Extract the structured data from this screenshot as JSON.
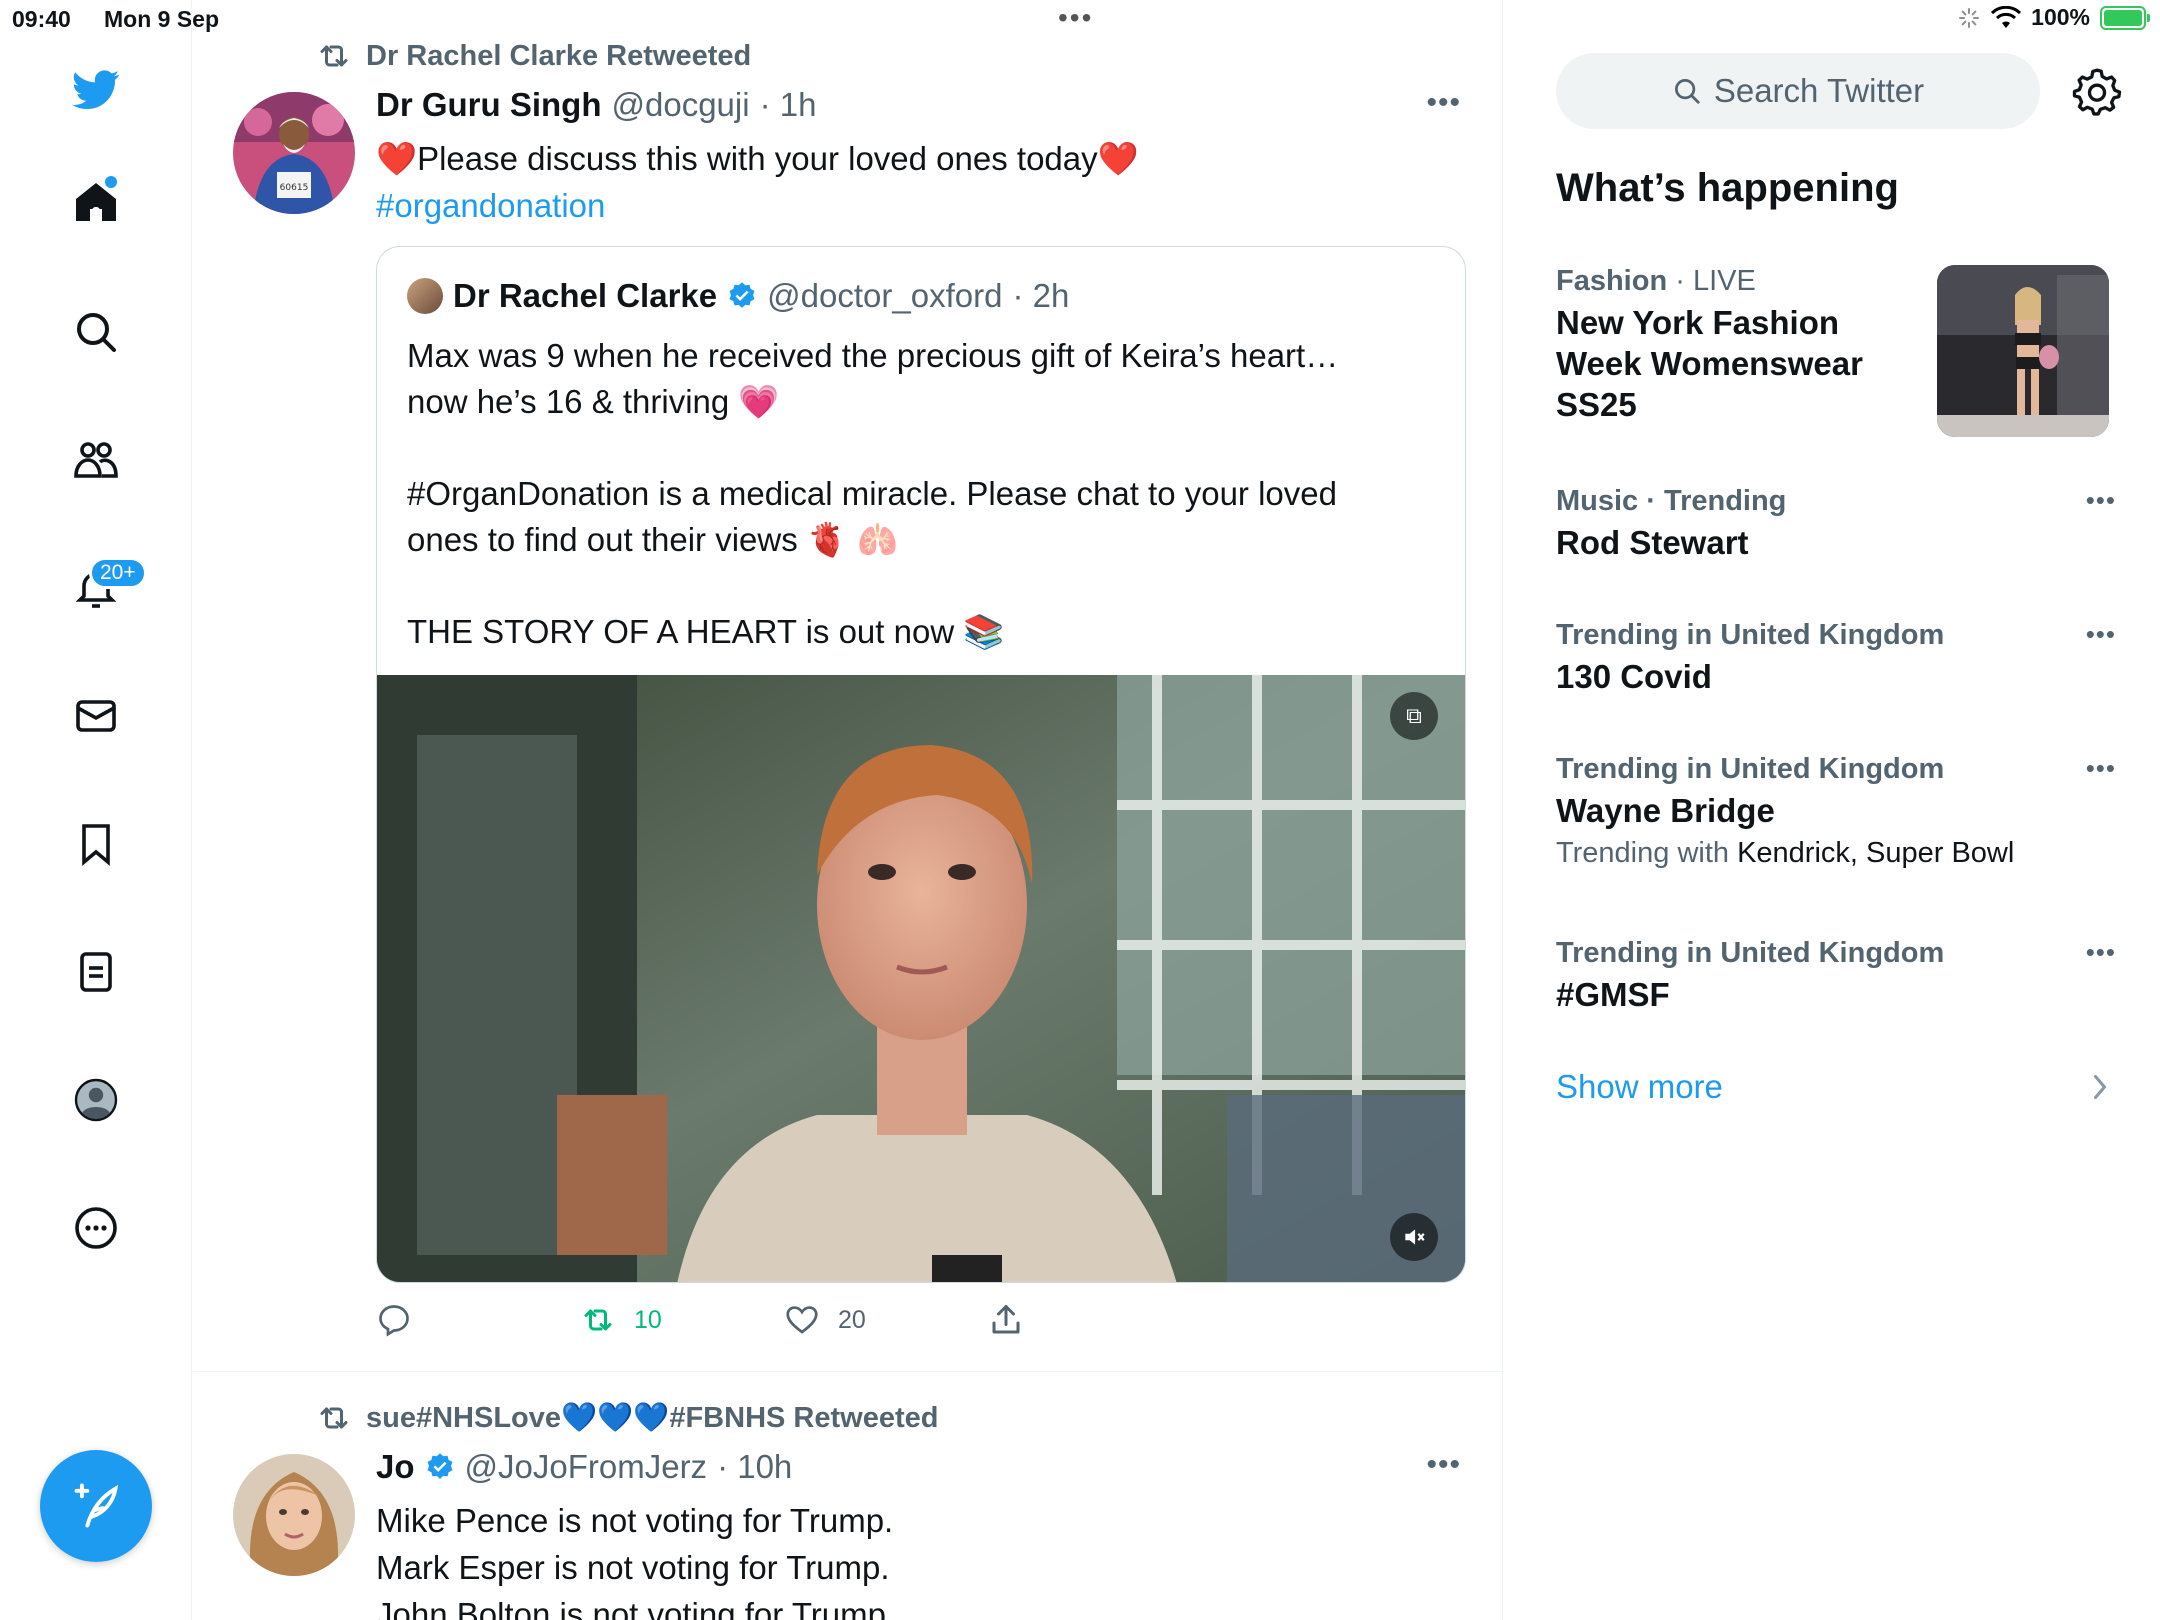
{
  "status_bar": {
    "time": "09:40",
    "date": "Mon 9 Sep",
    "battery": "100%"
  },
  "sidebar": {
    "notifications_badge": "20+",
    "items": [
      "home",
      "explore",
      "communities",
      "notifications",
      "messages",
      "bookmarks",
      "lists",
      "profile",
      "more"
    ]
  },
  "tweets": [
    {
      "retweeted_by": "Dr Rachel Clarke Retweeted",
      "name": "Dr Guru Singh",
      "handle": "@docguji",
      "time": "· 1h",
      "text_prefix": "❤️",
      "text": "Please discuss this with your loved ones today",
      "text_suffix": "❤️",
      "hashtag": "#organdonation",
      "quote": {
        "name": "Dr Rachel Clarke",
        "handle": "@doctor_oxford",
        "time": "· 2h",
        "text": "Max was 9 when he received the precious gift of Keira’s heart…\nnow he’s 16 & thriving 💗\n\n#OrganDonation is a medical miracle. Please chat to your loved\nones to find out their views  🫀 🫁\n\nTHE STORY OF A HEART is out now 📚"
      },
      "retweets": "10",
      "likes": "20"
    },
    {
      "retweeted_by": "sue#NHSLove💙💙💙#FBNHS Retweeted",
      "name": "Jo",
      "handle": "@JoJoFromJerz",
      "time": "· 10h",
      "lines": [
        "Mike Pence is not voting for Trump.",
        "Mark Esper is not voting for Trump.",
        "John Bolton is not voting for Trump."
      ]
    }
  ],
  "right": {
    "search_placeholder": "Search Twitter",
    "whats_happening": "What’s happening",
    "trends": [
      {
        "meta_category": "Fashion",
        "meta_rest": " · LIVE",
        "title": "New York Fashion Week Womenswear SS25"
      },
      {
        "meta": "Music · Trending",
        "title": "Rod Stewart"
      },
      {
        "meta": "Trending in United Kingdom",
        "title": "130 Covid"
      },
      {
        "meta": "Trending in United Kingdom",
        "title": "Wayne Bridge",
        "with_label": "Trending with ",
        "with_value": "Kendrick, Super Bowl"
      },
      {
        "meta": "Trending in United Kingdom",
        "title": "#GMSF"
      }
    ],
    "show_more": "Show more"
  },
  "colors": {
    "accent": "#1d9bf0",
    "retweet_green": "#00ba7c",
    "secondary_text": "#536471"
  }
}
